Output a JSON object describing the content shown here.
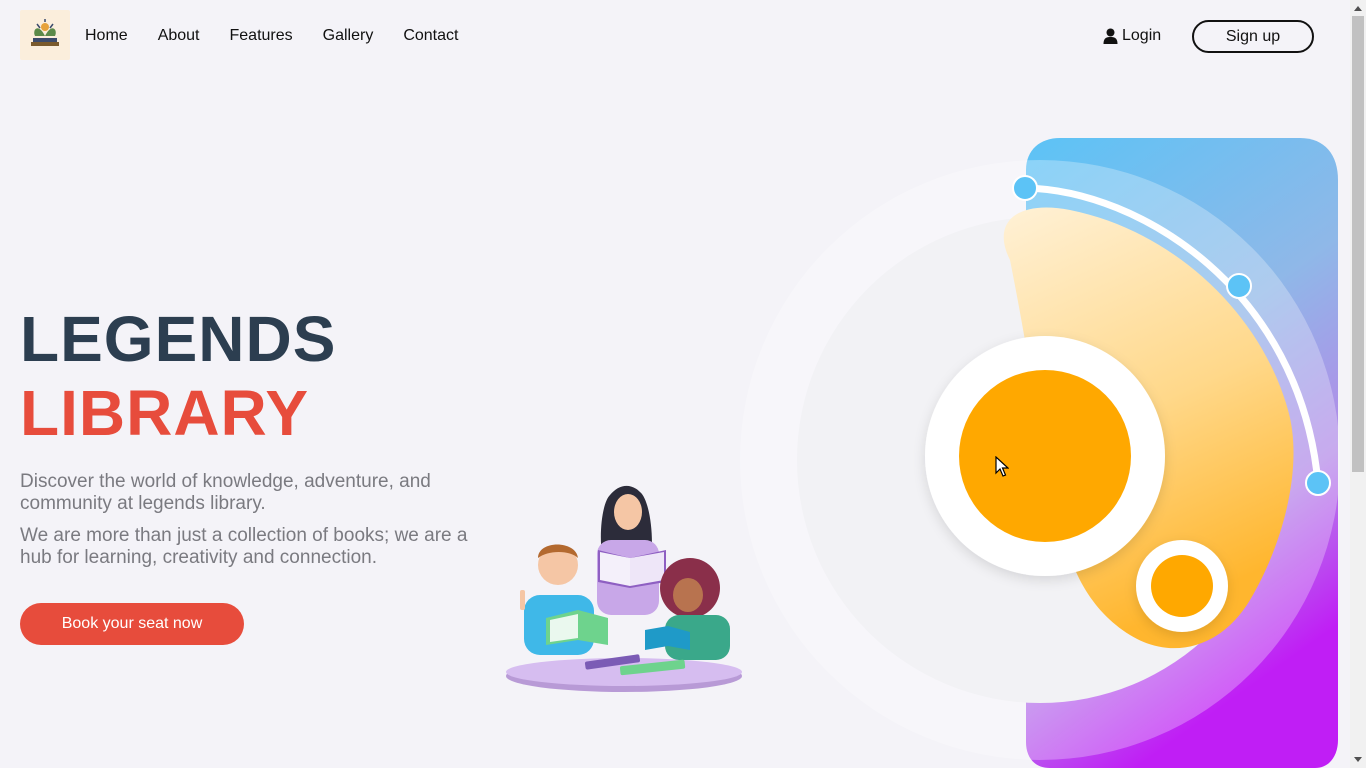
{
  "nav": {
    "links": [
      "Home",
      "About",
      "Features",
      "Gallery",
      "Contact"
    ],
    "login_label": "Login",
    "signup_label": "Sign up"
  },
  "hero": {
    "title_line1": "LEGENDS",
    "title_line2": "LIBRARY",
    "paragraph1": "Discover the world of knowledge, adventure, and community at legends library.",
    "paragraph2": "We are more than just a collection of books; we are a hub for learning, creativity and connection.",
    "cta_label": "Book your seat now"
  },
  "colors": {
    "title_dark": "#2c3e50",
    "title_accent": "#e74c3c",
    "cta": "#e74c3c",
    "orange": "#ffa800",
    "blue": "#5cc3f6",
    "purple": "#c01ef5"
  },
  "icons": {
    "login": "user-icon",
    "logo": "library-logo",
    "cursor": "mouse-cursor-icon"
  }
}
